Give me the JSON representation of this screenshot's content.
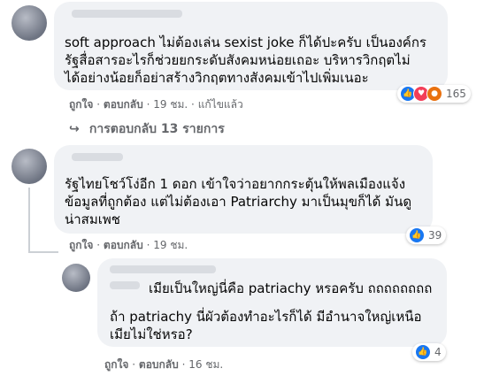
{
  "comment1": {
    "lines": [
      "soft approach ไม่ต้องเล่น sexist joke ก็ได้ปะครับ เป็นองค์กร",
      "รัฐสื่อสารอะไรก็ช่วยยกระดับสังคมหน่อยเถอะ บริหารวิกฤตไม่",
      "ได้อย่างน้อยก็อย่าสร้างวิกฤตทางสังคมเข้าไปเพิ่มเนอะ"
    ],
    "like": "ถูกใจ",
    "reply": "ตอบกลับ",
    "time": "19 ชม.",
    "edited": "แก้ไขแล้ว",
    "reactions": {
      "count": "165",
      "icons": [
        "like-icon",
        "love-icon",
        "angry-icon"
      ]
    },
    "view_replies": "การตอบกลับ 13 รายการ",
    "sep": "·"
  },
  "comment2": {
    "lines": [
      "รัฐไทยโชว์โง่อีก 1 ดอก เข้าใจว่าอยากกระตุ้นให้พลเมืองแจ้ง",
      "ข้อมูลที่ถูกต้อง แต่ไม่ต้องเอา Patriarchy มาเป็นมุขก็ได้ มันดู",
      "น่าสมเพช"
    ],
    "like": "ถูกใจ",
    "reply": "ตอบกลับ",
    "time": "19 ชม.",
    "reactions": {
      "count": "39",
      "icons": [
        "like-icon"
      ]
    },
    "sep": "·"
  },
  "reply1": {
    "lines": [
      "เมียเป็นใหญ่นี่คือ patriachy หรอครับ ถถถถถถถถ",
      "ถ้า patriachy นี่ผัวต้องทำอะไรก็ได้ มีอำนาจใหญ่เหนือ",
      "เมียไม่ใช่หรอ?"
    ],
    "like": "ถูกใจ",
    "reply": "ตอบกลับ",
    "time": "16 ชม.",
    "reactions": {
      "count": "4",
      "icons": [
        "like-icon"
      ]
    },
    "sep": "·"
  },
  "colors": {
    "link": "#65676b",
    "bubble": "#f0f2f5",
    "like": "#1877f2",
    "love": "#f33e58",
    "angry": "#e9710f"
  }
}
